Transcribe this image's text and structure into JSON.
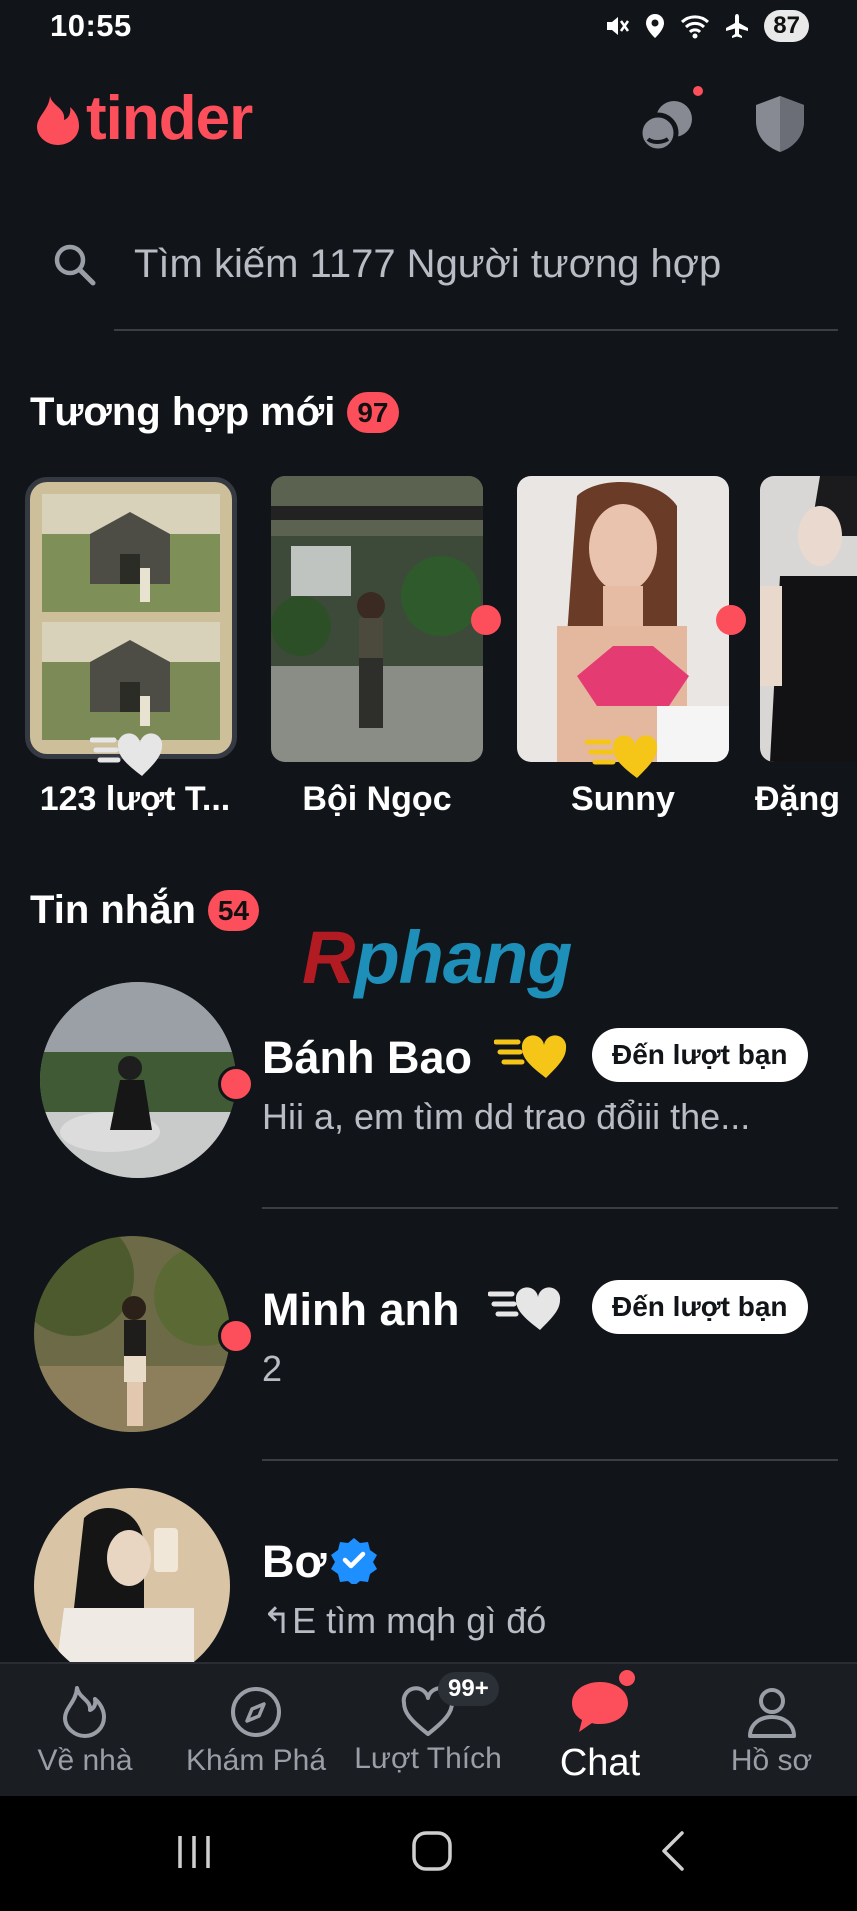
{
  "status_bar": {
    "time": "10:55",
    "battery": "87",
    "icons": [
      "mute-icon",
      "location-icon",
      "wifi-icon",
      "airplane-icon",
      "battery-icon"
    ]
  },
  "header": {
    "logo": "tinder",
    "brand_color": "#fd4f5b",
    "icons": [
      "matchmaker-icon",
      "shield-icon"
    ]
  },
  "search": {
    "placeholder": "Tìm kiếm 1177 Người tương hợp"
  },
  "new_matches": {
    "title": "Tương hợp mới",
    "count": "97",
    "items": [
      {
        "name": "123 lượt T...",
        "type": "likes",
        "badge": "silver-super-like-icon"
      },
      {
        "name": "Bội Ngọc",
        "unread_dot": true
      },
      {
        "name": "Sunny",
        "unread_dot": true,
        "badge": "gold-super-like-icon"
      },
      {
        "name": "Đặng"
      }
    ]
  },
  "messages": {
    "title": "Tin nhắn",
    "count": "54",
    "items": [
      {
        "name": "Bánh Bao",
        "preview": "Hii a, em tìm dd trao đổiii the...",
        "turn": "Đến lượt bạn",
        "badge": "gold-super-like-icon",
        "online": true
      },
      {
        "name": "Minh anh",
        "preview": "2",
        "turn": "Đến lượt bạn",
        "badge": "silver-super-like-icon",
        "online": true
      },
      {
        "name": "Bơ",
        "preview": "↰E tìm mqh gì đó",
        "verified": true
      }
    ]
  },
  "watermark": {
    "first": "R",
    "rest": "phang"
  },
  "bottom_nav": {
    "items": [
      {
        "label": "Về nhà",
        "icon": "flame-icon"
      },
      {
        "label": "Khám Phá",
        "icon": "compass-icon"
      },
      {
        "label": "Lượt Thích",
        "icon": "heart-icon",
        "badge": "99+"
      },
      {
        "label": "Chat",
        "icon": "chat-bubble-icon",
        "active": true
      },
      {
        "label": "Hồ sơ",
        "icon": "profile-icon"
      }
    ]
  },
  "system_nav": [
    "recents-icon",
    "home-icon",
    "back-icon"
  ]
}
